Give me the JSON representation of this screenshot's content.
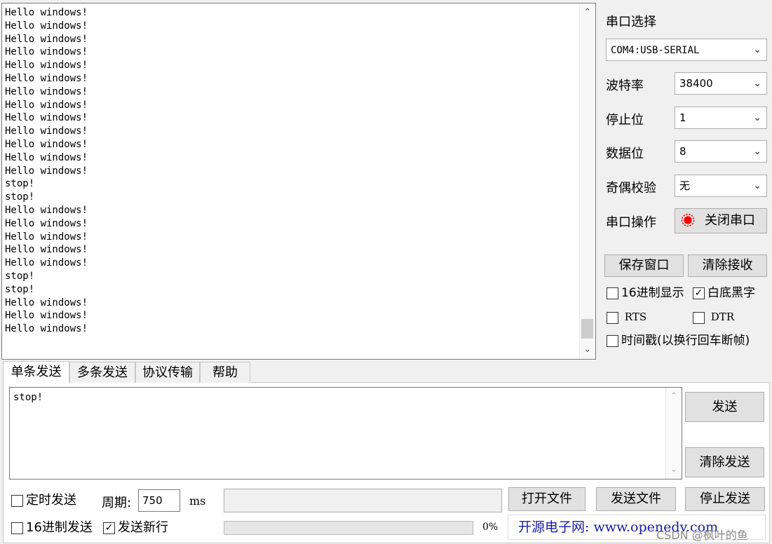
{
  "receive": {
    "lines": [
      "Hello windows!",
      "Hello windows!",
      "Hello windows!",
      "Hello windows!",
      "Hello windows!",
      "Hello windows!",
      "Hello windows!",
      "Hello windows!",
      "Hello windows!",
      "Hello windows!",
      "Hello windows!",
      "Hello windows!",
      "Hello windows!",
      "stop!",
      "stop!",
      "Hello windows!",
      "Hello windows!",
      "Hello windows!",
      "Hello windows!",
      "Hello windows!",
      "stop!",
      "stop!",
      "Hello windows!",
      "Hello windows!",
      "Hello windows!"
    ],
    "text": ""
  },
  "settings": {
    "port_select_label": "串口选择",
    "port_value": "COM4:USB-SERIAL",
    "baud_label": "波特率",
    "baud_value": "38400",
    "stopbits_label": "停止位",
    "stopbits_value": "1",
    "databits_label": "数据位",
    "databits_value": "8",
    "parity_label": "奇偶校验",
    "parity_value": "无",
    "port_op_label": "串口操作",
    "close_port_label": "关闭串口",
    "save_window_label": "保存窗口",
    "clear_receive_label": "清除接收",
    "hex_display_label": "16进制显示",
    "hex_display_checked": false,
    "white_bg_label": "白底黑字",
    "white_bg_checked": true,
    "rts_label": "RTS",
    "rts_checked": false,
    "dtr_label": "DTR",
    "dtr_checked": false,
    "timestamp_label": "时间戳(以换行回车断帧)",
    "timestamp_checked": false
  },
  "tabs": [
    {
      "label": "单条发送",
      "active": true
    },
    {
      "label": "多条发送",
      "active": false
    },
    {
      "label": "协议传输",
      "active": false
    },
    {
      "label": "帮助",
      "active": false
    }
  ],
  "send": {
    "text": "stop!",
    "send_label": "发送",
    "clear_send_label": "清除发送",
    "timed_send_label": "定时发送",
    "timed_send_checked": false,
    "period_label": "周期:",
    "period_value": "750",
    "period_unit": "ms",
    "open_file_label": "打开文件",
    "send_file_label": "发送文件",
    "stop_send_label": "停止发送",
    "hex_send_label": "16进制发送",
    "hex_send_checked": false,
    "newline_label": "发送新行",
    "newline_checked": true,
    "progress_text": "0%",
    "progress": 0
  },
  "footer": {
    "ad_text": "开源电子网: www.openedv.com",
    "watermark": "CSDN @枫叶的鱼"
  },
  "colors": {
    "window_bg": "#f0f0f0",
    "button_bg": "#e1e1e1",
    "indicator_red": "#ff0000",
    "ad_text": "#1a1aa8"
  }
}
